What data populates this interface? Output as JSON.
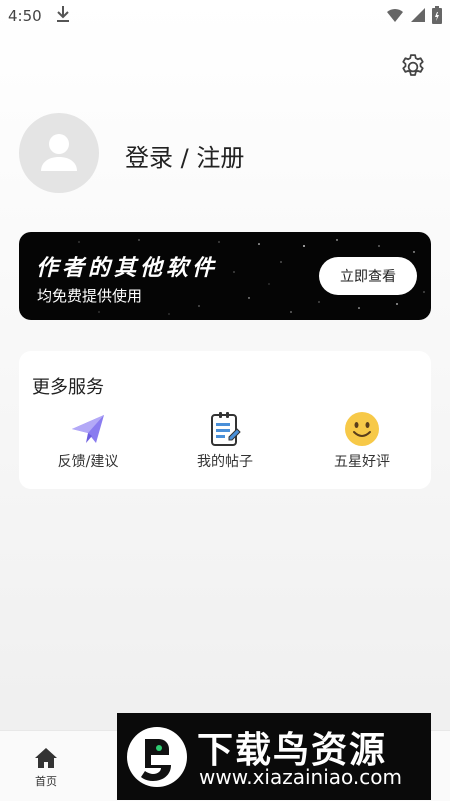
{
  "status_bar": {
    "time": "4:50"
  },
  "profile": {
    "login_label": "登录 / 注册"
  },
  "banner": {
    "title": "作者的其他软件",
    "subtitle": "均免费提供使用",
    "button_label": "立即查看"
  },
  "services": {
    "title": "更多服务",
    "items": [
      {
        "label": "反馈/建议",
        "icon": "paper-plane-icon"
      },
      {
        "label": "我的帖子",
        "icon": "notepad-icon"
      },
      {
        "label": "五星好评",
        "icon": "smiley-icon"
      }
    ]
  },
  "bottom_nav": {
    "home_label": "首页"
  },
  "watermark": {
    "title": "下载鸟资源",
    "url": "www.xiazainiao.com"
  },
  "colors": {
    "accent_purple": "#8a7cf0",
    "smiley_yellow": "#f7c948",
    "banner_bg": "#050505"
  }
}
